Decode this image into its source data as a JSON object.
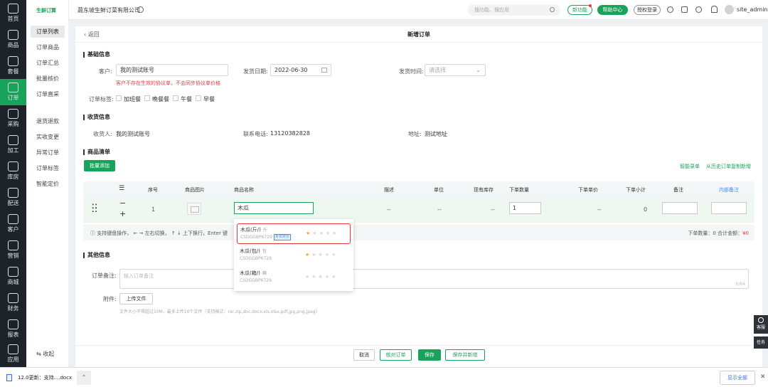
{
  "nav": [
    {
      "label": "首页",
      "icon": "home-icon"
    },
    {
      "label": "商品",
      "icon": "goods-icon"
    },
    {
      "label": "套餐",
      "icon": "package-icon"
    },
    {
      "label": "订单",
      "icon": "order-icon"
    },
    {
      "label": "采购",
      "icon": "cart-icon"
    },
    {
      "label": "加工",
      "icon": "process-icon"
    },
    {
      "label": "库房",
      "icon": "warehouse-icon"
    },
    {
      "label": "配送",
      "icon": "delivery-icon"
    },
    {
      "label": "客户",
      "icon": "customer-icon"
    },
    {
      "label": "营销",
      "icon": "marketing-icon"
    },
    {
      "label": "商城",
      "icon": "mall-icon"
    },
    {
      "label": "财务",
      "icon": "finance-icon"
    },
    {
      "label": "报表",
      "icon": "report-icon"
    },
    {
      "label": "应用",
      "icon": "apps-icon"
    }
  ],
  "sub": {
    "logo": "生鲜订算",
    "items": [
      "订单列表",
      "订单商品",
      "订单汇总",
      "批量核价",
      "订单直采",
      "退货退款",
      "实收变更",
      "异常订单",
      "订单标签",
      "智能定价"
    ],
    "collapse": "收起"
  },
  "topbar": {
    "company": "蔬东坡生鲜订菜有限公司",
    "search_placeholder": "搜功能、搜应用",
    "new_feature": "新功能",
    "help": "帮助中心",
    "auth_login": "授权登录",
    "user": "site_admin"
  },
  "page": {
    "back": "返回",
    "title": "新增订单"
  },
  "basic": {
    "title": "基础信息",
    "customer_label": "客户:",
    "customer_value": "我的测试账号",
    "warning": "客户不存在生效的协议单，不会同步协议单价格",
    "ship_date_label": "发货日期:",
    "ship_date_value": "2022-06-30",
    "ship_time_label": "发货时间:",
    "ship_time_placeholder": "请选择",
    "tags_label": "订单标签:",
    "tags": [
      "加班餐",
      "晚餐餐",
      "午餐",
      "早餐"
    ]
  },
  "receiver": {
    "title": "收货信息",
    "name_label": "收货人:",
    "name_value": "我的测试账号",
    "phone_label": "联系电话:",
    "phone_value": "13120382828",
    "address_label": "地址:",
    "address_value": "测试地址"
  },
  "goods": {
    "title": "商品清单",
    "batch_add": "批量添加",
    "smart_entry": "智能录单",
    "copy_history": "从历史订单复制新增",
    "headers": {
      "no": "序号",
      "image": "商品图片",
      "name": "商品名称",
      "desc": "描述",
      "unit": "单位",
      "stock": "现有库存",
      "qty": "下单数量",
      "price": "下单单价",
      "subtotal": "下单小计",
      "remark": "备注",
      "internal_remark": "内部备注"
    },
    "row": {
      "no": "1",
      "name": "木瓜",
      "desc": "--",
      "unit": "--",
      "stock": "--",
      "qty": "1",
      "price": "--",
      "subtotal": "0"
    },
    "hint": "支持键盘操作， ← → 左右切换， ↑ ↓ 上下换行，Enter 键",
    "total_qty_label": "下单数量：0",
    "total_amount_label": "合计金额：",
    "total_amount": "¥0",
    "suggestions": [
      {
        "name": "木瓜(斤/)",
        "unit": "斤",
        "code": "CSDGGBP6729",
        "tag": "折扣定价",
        "rating": 1
      },
      {
        "name": "木瓜(包/)",
        "unit": "包",
        "code": "CSDGGBP6729",
        "tag": "",
        "rating": 1
      },
      {
        "name": "木瓜(箱/)",
        "unit": "箱",
        "code": "CSDGGBP6729",
        "tag": "",
        "rating": 0
      }
    ]
  },
  "other": {
    "title": "其他信息",
    "remark_label": "订单备注:",
    "remark_placeholder": "输入订单备注",
    "remark_count": "0/64",
    "attach_label": "附件:",
    "upload": "上传文件",
    "upload_hint": "文件大小不得超过10M，最多上传10个文件（支持格式：rar,zip,doc,docx,xls,xlsx,pdf,jpg,png,jpeg）"
  },
  "footer": {
    "cancel": "取消",
    "check": "核对订单",
    "save": "保存",
    "save_add": "保存并新增"
  },
  "side_tools": {
    "service": "客服",
    "task": "任务"
  },
  "download": {
    "file": "12.0更新：支持....docx",
    "show_all": "显示全部"
  },
  "colors": {
    "brand": "#19a35a",
    "warning": "#e23c3c",
    "sidebar": "#1e2229"
  }
}
